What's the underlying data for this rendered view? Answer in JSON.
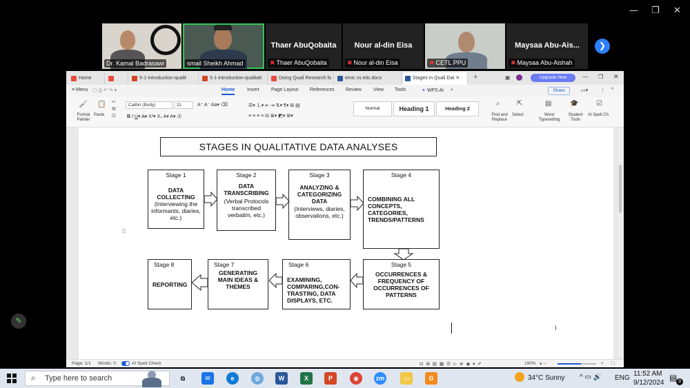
{
  "meeting": {
    "participants": [
      {
        "name": "Dr. Kamal Badrasawi",
        "muted": false
      },
      {
        "name": "smail Sheikh Ahmad",
        "muted": false
      },
      {
        "name": "Thaer AbuQobaita",
        "muted": true
      },
      {
        "name": "Nour al-din Eisa",
        "muted": true
      },
      {
        "name": "CETL PPU",
        "muted": true
      },
      {
        "name": "Maysaa Abu-Aishah",
        "muted": true
      }
    ],
    "big_names": {
      "t3": "Thaer AbuQobaita",
      "t4": "Nour al-din Eisa",
      "t6": "Maysaa  Abu-Ais..."
    },
    "next_icon": "chevron-right-icon"
  },
  "wps": {
    "tabs": [
      {
        "label": "Home",
        "color": "#e74c3c"
      },
      {
        "label": "",
        "color": "#e74c3c"
      },
      {
        "label": "5-1-introduction-qualit",
        "color": "#d24726"
      },
      {
        "label": "5-1-introduction-qualitati",
        "color": "#d24726"
      },
      {
        "label": "Doing Quail Research fo",
        "color": "#e74c3c"
      },
      {
        "label": "emic vs etic.docx",
        "color": "#2b579a"
      },
      {
        "label": "Stages in Quali Dat",
        "color": "#2b579a"
      }
    ],
    "new_tab": "+",
    "upgrade": "Upgrade Now",
    "menu": {
      "menu_btn": "Menu",
      "items": [
        "Home",
        "Insert",
        "Page Layout",
        "References",
        "Review",
        "View",
        "Tools"
      ],
      "wps_ai": "WPS AI",
      "share": "Share"
    },
    "ribbon": {
      "format_painter": "Format Painter",
      "paste": "Paste",
      "font": "Calibri (Body)",
      "size": "11",
      "styles": [
        "Normal",
        "Heading 1",
        "Heading 2"
      ],
      "find_replace": "Find and Replace",
      "select": "Select",
      "word_typesetting": "Word Typesetting",
      "student_tools": "Student Tools",
      "ai_spell": "AI Spell Ch"
    },
    "status": {
      "page": "Page: 1/1",
      "words": "Words: 0",
      "spell": "AI Spell Check",
      "zoom": "190%",
      "zoom_fraction": 0.6
    }
  },
  "diagram": {
    "title": "STAGES IN QUALITATIVE DATA ANALYSES",
    "stages": [
      {
        "label": "Stage 1",
        "head": "DATA COLLECTING",
        "body": "(Interviewing the informants, diaries, etc.)"
      },
      {
        "label": "Stage 2",
        "head": "DATA TRANSCRIBING",
        "body": "(Verbal Protocols transcribed verbatim, etc.)"
      },
      {
        "label": "Stage 3",
        "head": "ANALYZING & CATEGORIZING DATA",
        "body": "(Interviews, diaries, observations, etc.)"
      },
      {
        "label": "Stage 4",
        "head": "COMBINING ALL CONCEPTS, CATEGORIES, TRENDS/PATTERNS",
        "body": ""
      },
      {
        "label": "Stage 5",
        "head": "OCCURRENCES & FREQUENCY OF OCCURRENCES OF PATTERNS",
        "body": ""
      },
      {
        "label": "Stage 6",
        "head": "EXAMINING, COMPARING,CON-TRASTING, DATA DISPLAYS, ETC.",
        "body": ""
      },
      {
        "label": "Stage 7",
        "head": "GENERATING MAIN IDEAS & THEMES",
        "body": ""
      },
      {
        "label": "Stage 8",
        "head": "REPORTING",
        "body": ""
      }
    ]
  },
  "taskbar": {
    "search_placeholder": "Type here to search",
    "weather": "34°C  Sunny",
    "lang": "ENG",
    "time": "11:52 AM",
    "date": "9/12/2024",
    "notif_count": "3"
  }
}
